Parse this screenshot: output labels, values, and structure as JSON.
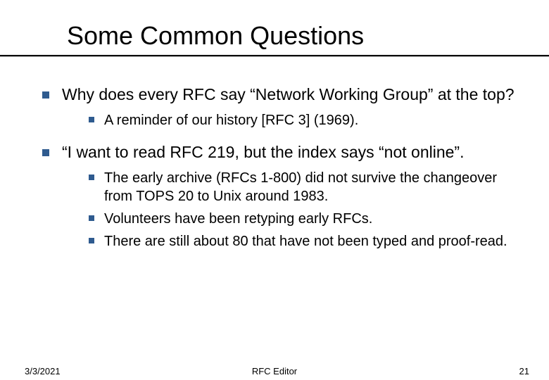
{
  "title": "Some Common Questions",
  "bullets": {
    "q1": "Why does every RFC say “Network Working Group” at the top?",
    "q1_sub1": "A reminder of our history  [RFC 3] (1969).",
    "q2": "“I want to read RFC 219, but the index says “not online”.",
    "q2_sub1": "The early archive (RFCs 1-800) did not survive the changeover from TOPS 20 to Unix around 1983.",
    "q2_sub2": "Volunteers have been retyping early RFCs.",
    "q2_sub3": "There are still about 80 that have not been typed and proof-read."
  },
  "footer": {
    "date": "3/3/2021",
    "center": "RFC Editor",
    "page": "21"
  },
  "colors": {
    "bullet": "#2f5b8f"
  }
}
